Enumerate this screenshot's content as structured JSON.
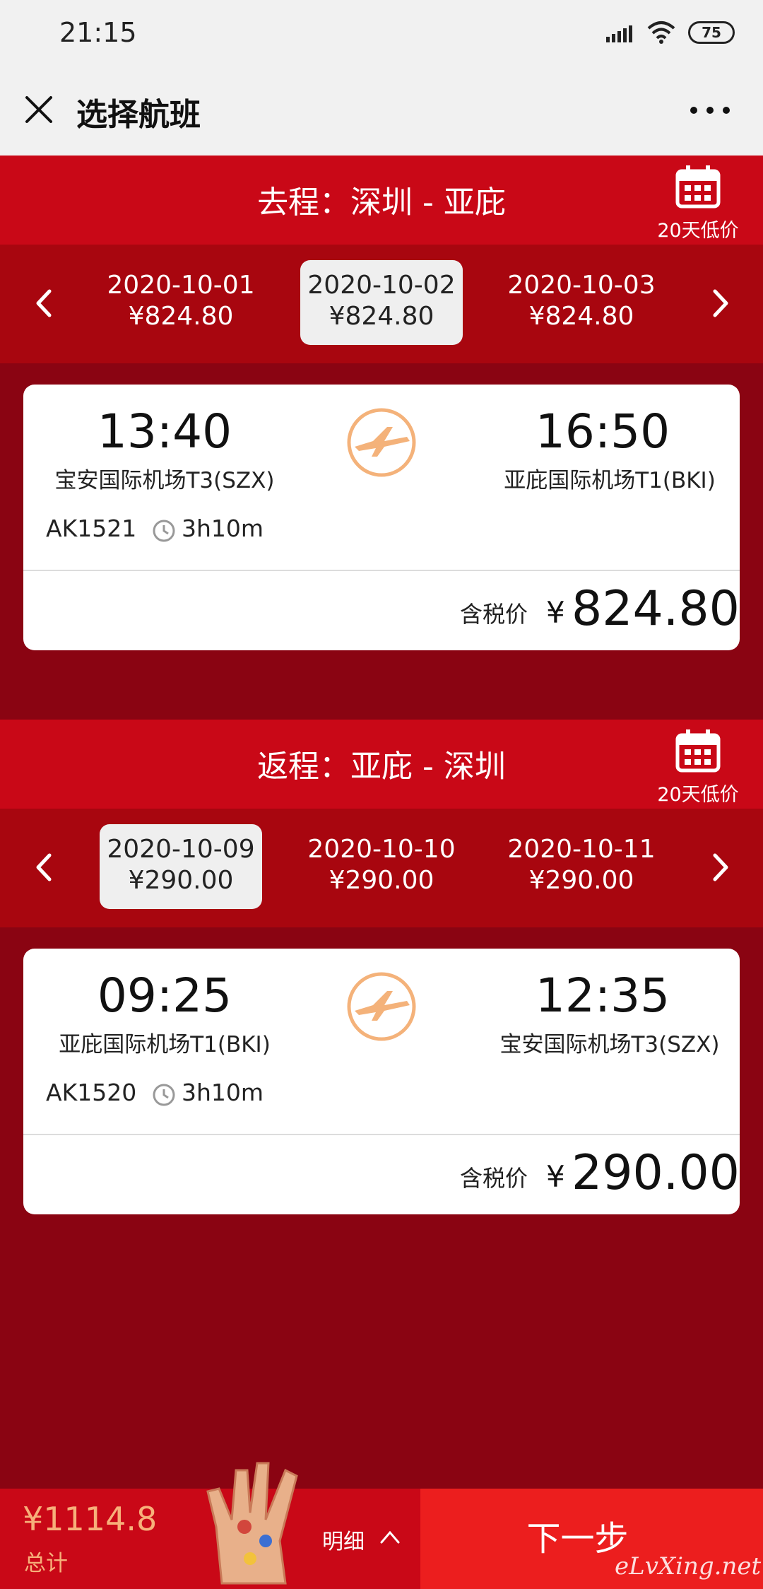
{
  "status": {
    "time": "21:15",
    "battery": "75"
  },
  "nav": {
    "title": "选择航班"
  },
  "outbound": {
    "route": "去程：深圳 - 亚庇",
    "calendar_label": "20天低价",
    "dates": [
      {
        "date": "2020-10-01",
        "price": "¥824.80",
        "selected": false
      },
      {
        "date": "2020-10-02",
        "price": "¥824.80",
        "selected": true
      },
      {
        "date": "2020-10-03",
        "price": "¥824.80",
        "selected": false
      }
    ],
    "flight": {
      "dep_time": "13:40",
      "dep_airport": "宝安国际机场T3(SZX)",
      "arr_time": "16:50",
      "arr_airport": "亚庇国际机场T1(BKI)",
      "flight_no": "AK1521",
      "duration": "3h10m",
      "price_label": "含税价",
      "currency": "¥",
      "price": "824.80"
    }
  },
  "return": {
    "route": "返程：亚庇 - 深圳",
    "calendar_label": "20天低价",
    "dates": [
      {
        "date": "2020-10-09",
        "price": "¥290.00",
        "selected": true
      },
      {
        "date": "2020-10-10",
        "price": "¥290.00",
        "selected": false
      },
      {
        "date": "2020-10-11",
        "price": "¥290.00",
        "selected": false
      }
    ],
    "flight": {
      "dep_time": "09:25",
      "dep_airport": "亚庇国际机场T1(BKI)",
      "arr_time": "12:35",
      "arr_airport": "宝安国际机场T3(SZX)",
      "flight_no": "AK1520",
      "duration": "3h10m",
      "price_label": "含税价",
      "currency": "¥",
      "price": "290.00"
    }
  },
  "bottom": {
    "total_amount": "¥1114.8",
    "total_label": "总计",
    "detail_label": "明细",
    "next_label": "下一步"
  },
  "watermark": "eLvXing.net",
  "colors": {
    "header_red": "#c90817",
    "strip_red": "#a8060f",
    "bg_red": "#8a0412",
    "next_red": "#ec1e1e",
    "price_orange": "#f7b07a",
    "logo_orange": "#f4b27a"
  }
}
